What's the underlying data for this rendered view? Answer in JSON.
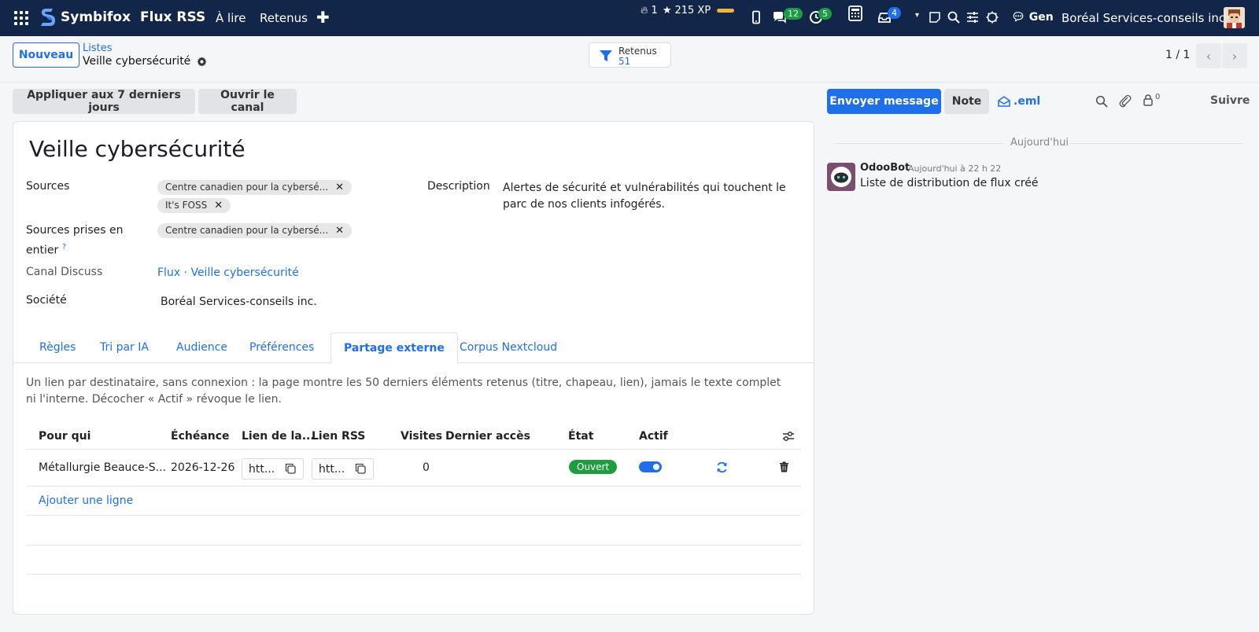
{
  "navbar": {
    "brand": "Symbifox",
    "app_name": "Flux RSS",
    "menu": [
      "À lire",
      "Retenus"
    ],
    "streak": "1",
    "xp": "215 XP",
    "messages_count": "12",
    "activities_count": "5",
    "inbox_count": "4",
    "gen_label": "Gen",
    "company": "Boréal Services-conseils inc."
  },
  "control": {
    "new_button": "Nouveau",
    "breadcrumb_parent": "Listes",
    "breadcrumb_current": "Veille cybersécurité",
    "filter_label": "Retenus",
    "filter_count": "51",
    "pager": "1 / 1"
  },
  "actions": {
    "apply_7_days": "Appliquer aux 7 derniers jours",
    "open_channel": "Ouvrir le canal",
    "send_message": "Envoyer message",
    "note": "Note",
    "eml": ".eml",
    "followers_count": "0",
    "follow": "Suivre"
  },
  "form": {
    "title": "Veille cybersécurité",
    "sources_label": "Sources",
    "sources": [
      "Centre canadien pour la cybersé...",
      "It's FOSS"
    ],
    "sources_full_label_1": "Sources prises en",
    "sources_full_label_2": "entier",
    "help_mark": "?",
    "sources_full": [
      "Centre canadien pour la cybersé..."
    ],
    "channel_label": "Canal Discuss",
    "channel_value": "Flux · Veille cybersécurité",
    "company_label": "Société",
    "company_value": "Boréal Services-conseils inc.",
    "description_label": "Description",
    "description_value": "Alertes de sécurité et vulnérabilités qui touchent le parc de nos clients infogérés."
  },
  "tabs": [
    "Règles",
    "Tri par IA",
    "Audience",
    "Préférences",
    "Partage externe",
    "Corpus Nextcloud"
  ],
  "external_share": {
    "note": "Un lien par destinataire, sans connexion : la page montre les 50 derniers éléments retenus (titre, chapeau, lien), jamais le texte complet ni l'interne. Décocher « Actif » révoque le lien.",
    "columns": [
      "Pour qui",
      "Échéance",
      "Lien de la...",
      "Lien RSS",
      "Visites",
      "Dernier accès",
      "État",
      "Actif"
    ],
    "rows": [
      {
        "who": "Métallurgie Beauce-S...",
        "deadline": "2026-12-26",
        "page_link": "htt...",
        "rss_link": "htt...",
        "visits": "0",
        "last_access": "",
        "state": "Ouvert",
        "active": true
      }
    ],
    "add_line": "Ajouter une ligne"
  },
  "chatter": {
    "date_separator": "Aujourd'hui",
    "messages": [
      {
        "author": "OdooBot",
        "time": "Aujourd'hui à 22 h 22",
        "body": "Liste de distribution de flux créé"
      }
    ]
  },
  "colors": {
    "navbar_bg": "#12264a",
    "accent": "#1f6feb",
    "success": "#1f9d3e",
    "xp_bar": "#f0b43c"
  }
}
